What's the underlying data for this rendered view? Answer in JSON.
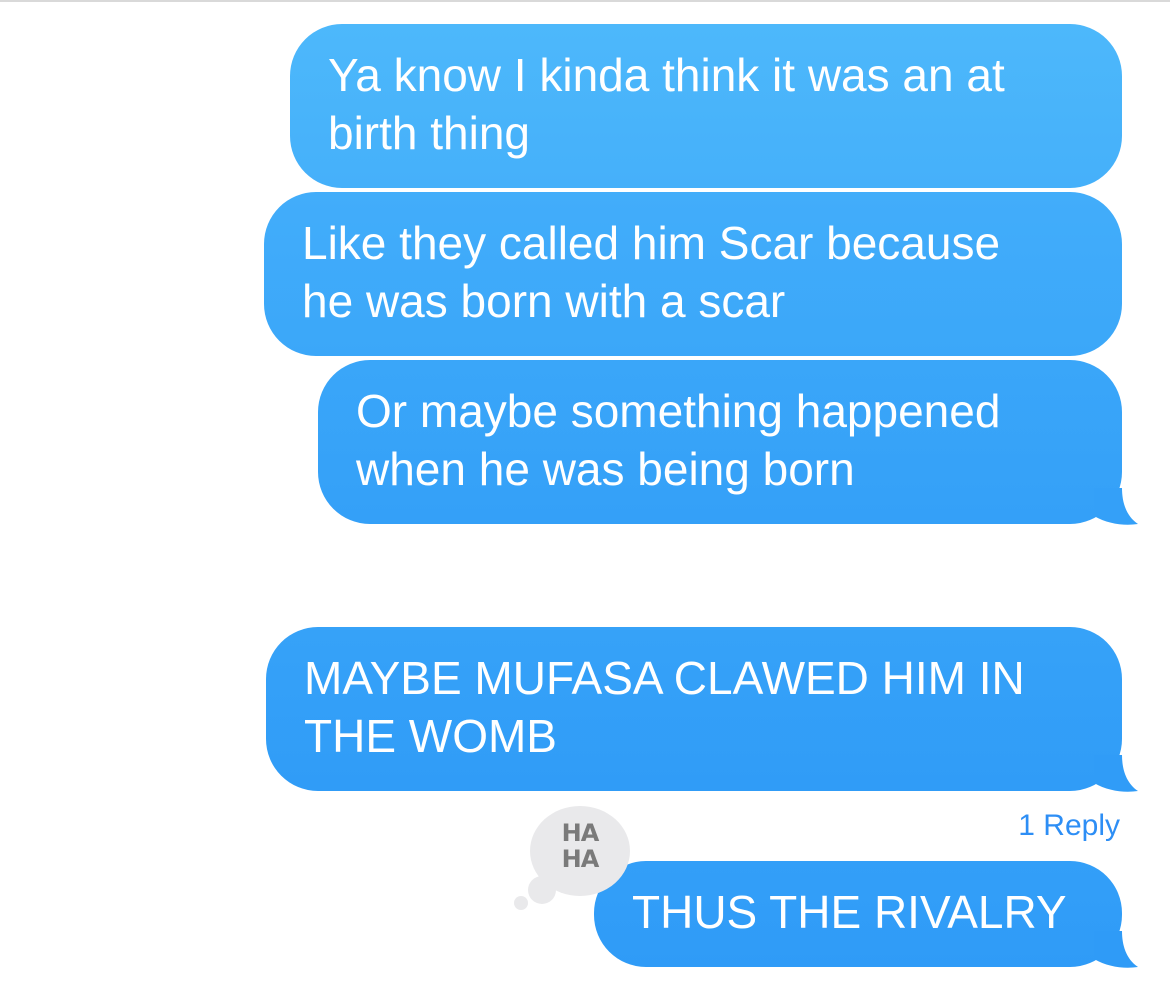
{
  "messages": [
    {
      "text_line1": "Ya know I kinda think it was an at",
      "text_line2": "birth thing"
    },
    {
      "text_line1": "Like they called him Scar because",
      "text_line2": "he was born with a scar"
    },
    {
      "text_line1": "Or maybe something happened",
      "text_line2": "when he was being born"
    },
    {
      "text_line1": "MAYBE MUFASA CLAWED HIM IN",
      "text_line2": "THE WOMB"
    },
    {
      "text": "THUS THE RIVALRY"
    }
  ],
  "reply_link": "1 Reply",
  "tapback": {
    "line1": "HA",
    "line2": "HA",
    "icon": "haha-reaction-icon"
  },
  "colors": {
    "bubble_top": "#4db8fb",
    "bubble_bottom": "#2f9bf7",
    "link": "#2d8ef5",
    "tapback_bg": "#e9e9eb"
  }
}
